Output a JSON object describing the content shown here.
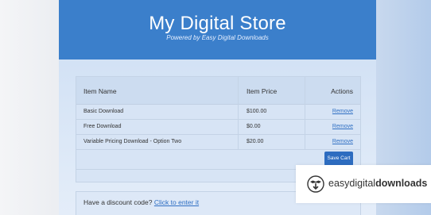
{
  "store": {
    "title": "My Digital Store",
    "subtitle": "Powered by Easy Digital Downloads"
  },
  "cart": {
    "headers": {
      "name": "Item Name",
      "price": "Item Price",
      "actions": "Actions"
    },
    "items": [
      {
        "name": "Basic Download",
        "price": "$100.00",
        "action": "Remove"
      },
      {
        "name": "Free Download",
        "price": "$0.00",
        "action": "Remove"
      },
      {
        "name": "Variable Pricing Download - Option Two",
        "price": "$20.00",
        "action": "Remove"
      }
    ],
    "save_label": "Save Cart"
  },
  "discount": {
    "prompt": "Have a discount code?",
    "link": "Click to enter it"
  },
  "brand": {
    "part1": "easy",
    "part2": "digital",
    "part3": "downloads",
    "logo_icon": "edd-logo-icon"
  },
  "colors": {
    "header": "#3b7fcb",
    "link": "#2f6fc3",
    "button": "#2d6cc0"
  }
}
